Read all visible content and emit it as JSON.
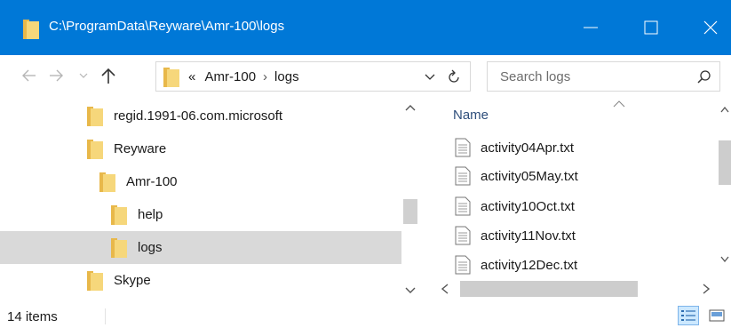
{
  "window": {
    "title": "C:\\ProgramData\\Reyware\\Amr-100\\logs",
    "accent_color": "#0078d7"
  },
  "toolbar": {
    "back_icon": "back-arrow-icon",
    "forward_icon": "forward-arrow-icon",
    "recent_icon": "chevron-down-icon",
    "up_icon": "up-arrow-icon"
  },
  "address": {
    "overflow": "«",
    "crumbs": [
      "Amr-100",
      "logs"
    ],
    "separator": "›"
  },
  "search": {
    "placeholder": "Search logs"
  },
  "nav_tree": [
    {
      "label": "regid.1991-06.com.microsoft",
      "selected": false
    },
    {
      "label": "Reyware",
      "selected": false
    },
    {
      "label": "Amr-100",
      "selected": false
    },
    {
      "label": "help",
      "selected": false
    },
    {
      "label": "logs",
      "selected": true
    },
    {
      "label": "Skype",
      "selected": false
    }
  ],
  "content": {
    "column_header": "Name",
    "files": [
      "activity04Apr.txt",
      "activity05May.txt",
      "activity10Oct.txt",
      "activity11Nov.txt",
      "activity12Dec.txt"
    ]
  },
  "status": {
    "item_count": "14 items"
  }
}
